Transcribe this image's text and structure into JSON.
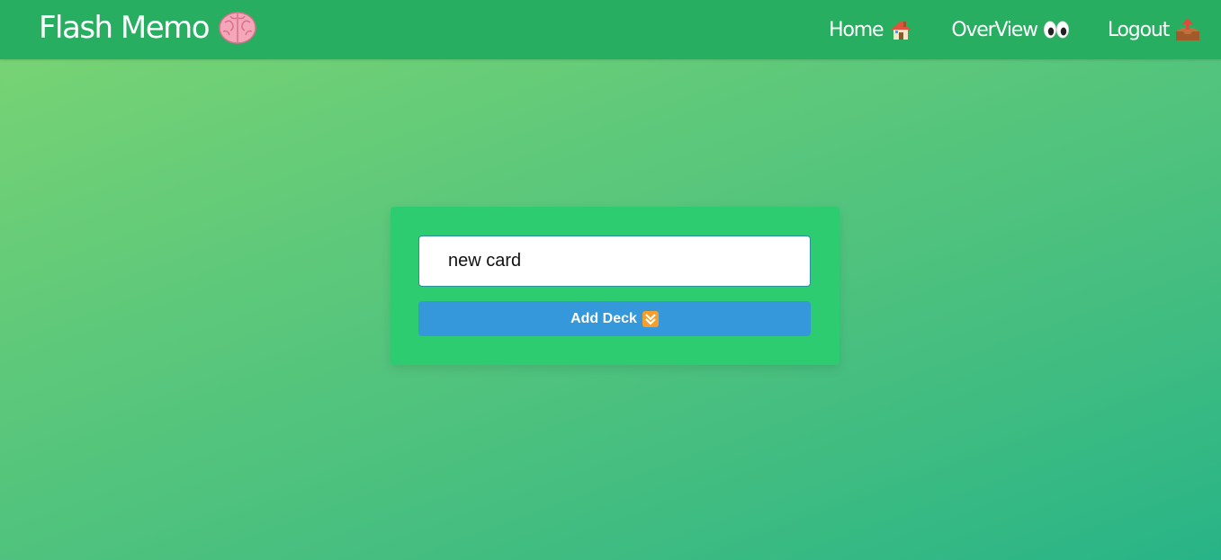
{
  "header": {
    "brand": "Flash Memo",
    "brand_icon": "brain-icon",
    "nav": [
      {
        "label": "Home",
        "icon": "house-icon"
      },
      {
        "label": "OverView",
        "icon": "eyes-icon"
      },
      {
        "label": "Logout",
        "icon": "outbox-tray-icon"
      }
    ]
  },
  "form": {
    "deck_input_value": "new card",
    "add_button_label": "Add Deck",
    "add_button_icon": "double-down-arrow-icon"
  },
  "colors": {
    "navbar": "#27ae60",
    "card": "#2ecc71",
    "button": "#3498db",
    "background_start": "#7cd573",
    "background_end": "#28b487"
  }
}
